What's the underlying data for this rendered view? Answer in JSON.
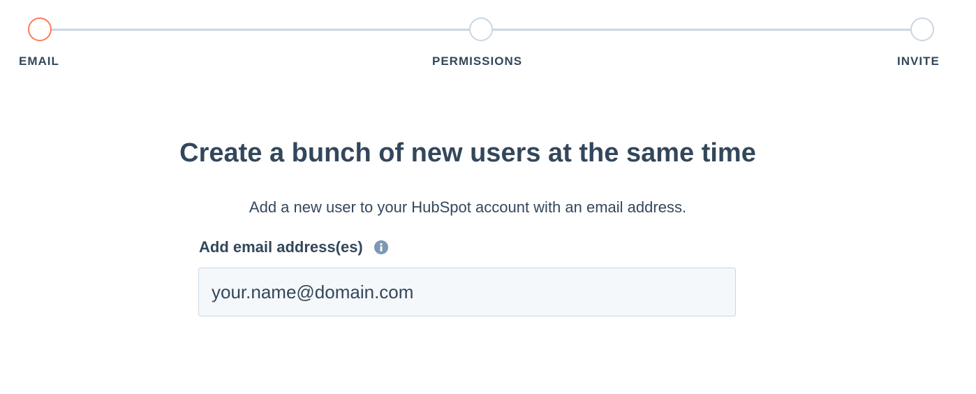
{
  "stepper": {
    "steps": [
      {
        "label": "EMAIL",
        "state": "active"
      },
      {
        "label": "PERMISSIONS",
        "state": "upcoming"
      },
      {
        "label": "INVITE",
        "state": "upcoming"
      }
    ],
    "colors": {
      "active": "#ff7a59",
      "inactive": "#cbd6e2"
    }
  },
  "main": {
    "title": "Create a bunch of new users at the same time",
    "subtitle": "Add a new user to your HubSpot account with an email address.",
    "email_field": {
      "label": "Add email address(es)",
      "info_icon": "info-icon",
      "placeholder": "your.name@domain.com",
      "value": ""
    }
  },
  "theme": {
    "text": "#33475b",
    "input_bg": "#f5f8fa",
    "input_border": "#cbd6e2",
    "info_icon_color": "#7c98b6"
  }
}
